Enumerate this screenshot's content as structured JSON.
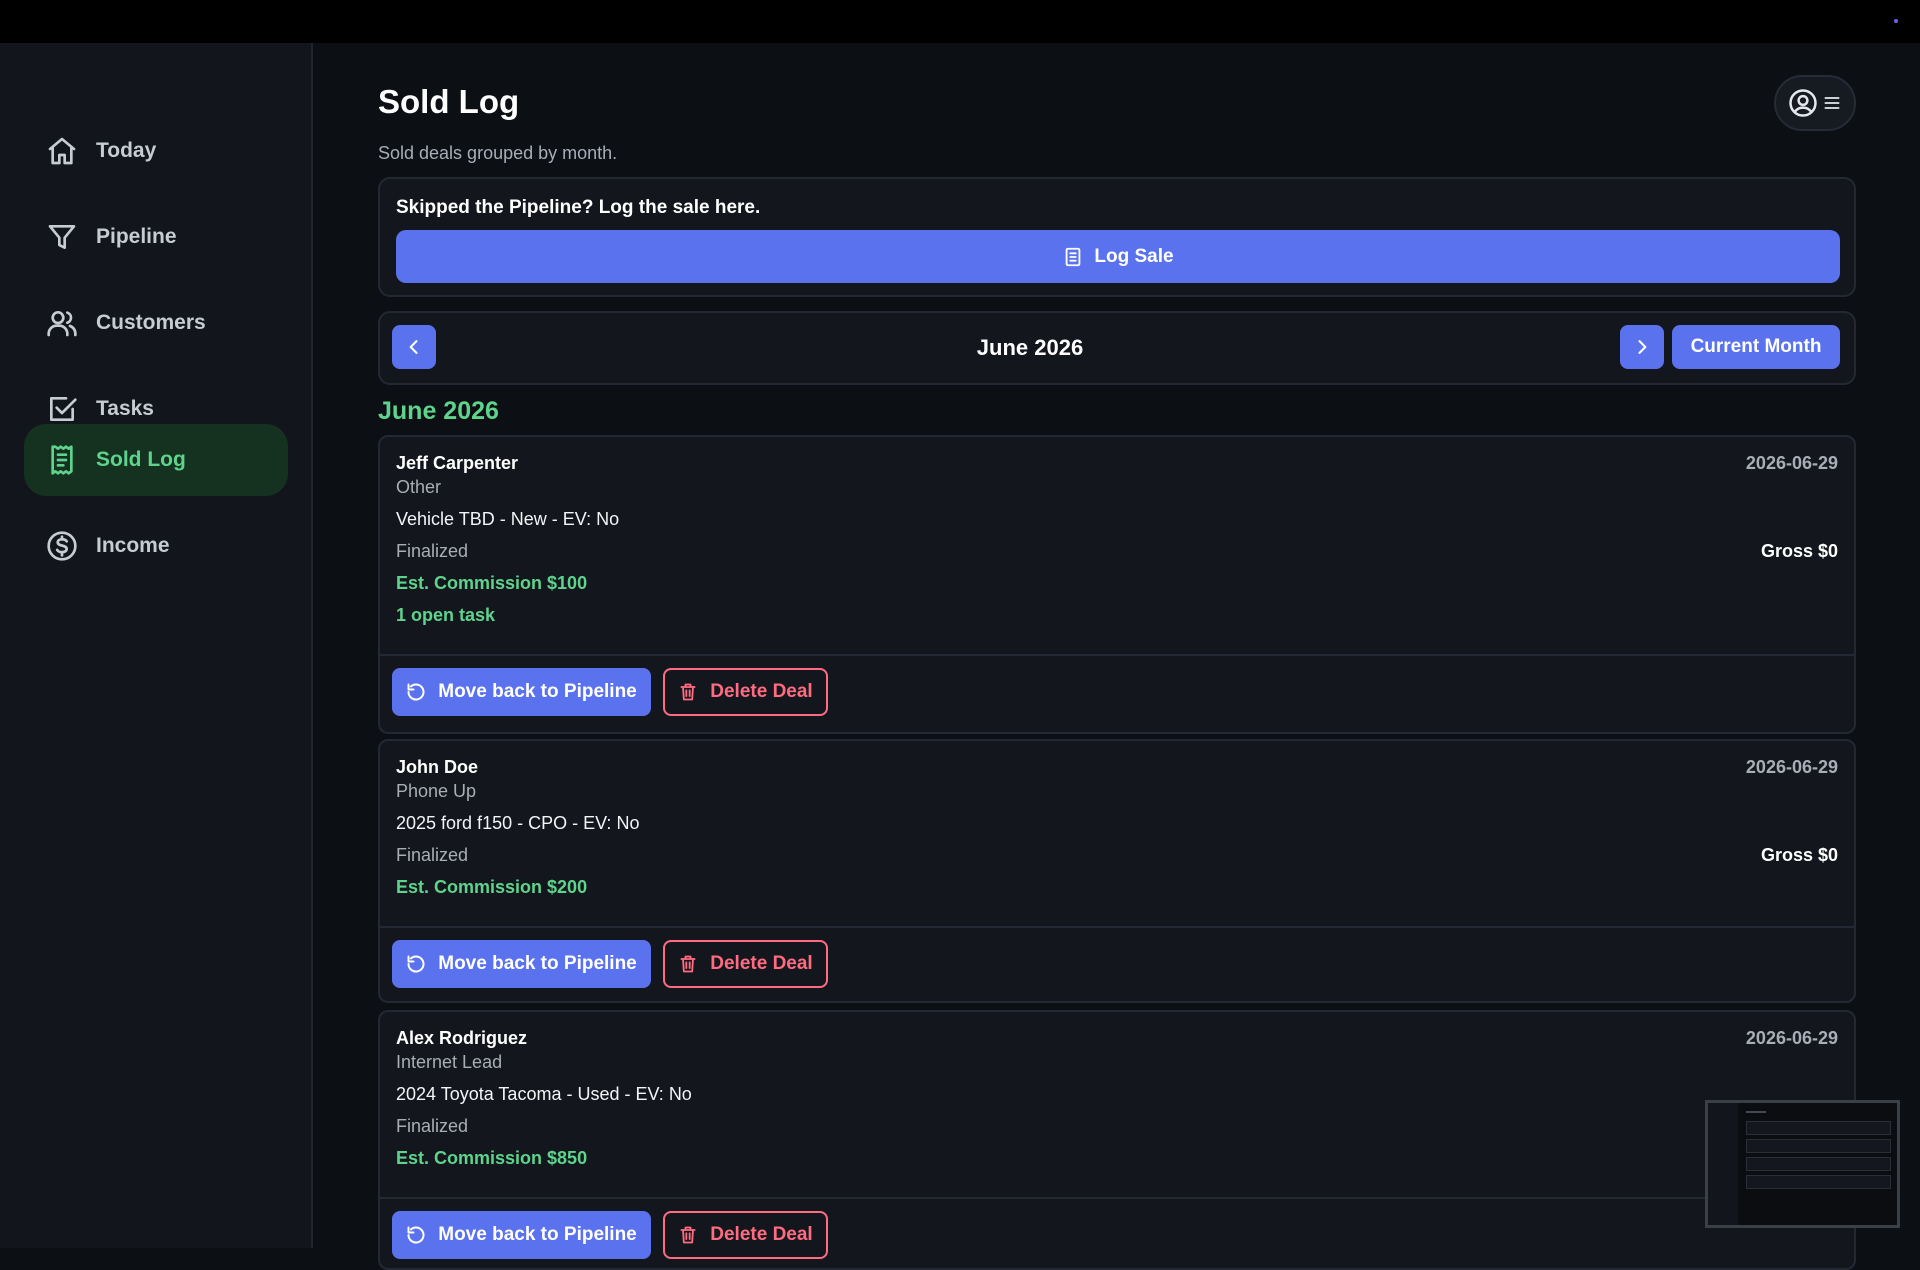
{
  "sidebar": {
    "items": [
      {
        "label": "Today",
        "icon": "home-icon"
      },
      {
        "label": "Pipeline",
        "icon": "funnel-icon"
      },
      {
        "label": "Customers",
        "icon": "users-icon"
      },
      {
        "label": "Tasks",
        "icon": "checkbox-icon"
      },
      {
        "label": "Sold Log",
        "icon": "receipt-icon",
        "active": true
      },
      {
        "label": "Income",
        "icon": "dollar-circle-icon"
      }
    ]
  },
  "header": {
    "title": "Sold Log",
    "subtitle": "Sold deals grouped by month."
  },
  "log_panel": {
    "prompt": "Skipped the Pipeline? Log the sale here.",
    "button_label": "Log Sale"
  },
  "month_nav": {
    "label": "June 2026",
    "current_month_label": "Current Month"
  },
  "group": {
    "heading": "June 2026"
  },
  "deals": [
    {
      "name": "Jeff Carpenter",
      "date": "2026-06-29",
      "source": "Other",
      "vehicle": "Vehicle TBD - New - EV: No",
      "status": "Finalized",
      "gross": "Gross $0",
      "commission": "Est. Commission $100",
      "open_tasks": "1 open task",
      "move_label": "Move back to Pipeline",
      "delete_label": "Delete Deal"
    },
    {
      "name": "John Doe",
      "date": "2026-06-29",
      "source": "Phone Up",
      "vehicle": "2025 ford f150 - CPO - EV: No",
      "status": "Finalized",
      "gross": "Gross $0",
      "commission": "Est. Commission $200",
      "move_label": "Move back to Pipeline",
      "delete_label": "Delete Deal"
    },
    {
      "name": "Alex Rodriguez",
      "date": "2026-06-29",
      "source": "Internet Lead",
      "vehicle": "2024 Toyota Tacoma - Used - EV: No",
      "status": "Finalized",
      "commission": "Est. Commission $850",
      "move_label": "Move back to Pipeline",
      "delete_label": "Delete Deal"
    }
  ],
  "colors": {
    "accent": "#5b72ee",
    "success": "#5ed38c",
    "danger": "#ff6b81",
    "background": "#0c0f14"
  }
}
